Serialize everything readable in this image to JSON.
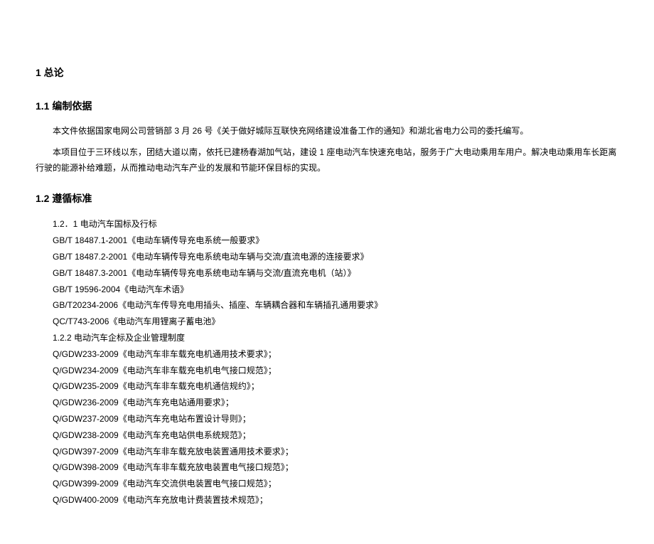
{
  "heading1": "1 总论",
  "section1": {
    "heading": "1.1  编制依据",
    "para1": "本文件依据国家电网公司营销部 3 月 26 号《关于做好城际互联快充网络建设准备工作的通知》和湖北省电力公司的委托编写。",
    "para2": "本项目位于三环线以东，团结大道以南，依托已建杨春湖加气站，建设 1 座电动汽车快速充电站，服务于广大电动乘用车用户。解决电动乘用车长距离行驶的能源补给难题，从而推动电动汽车产业的发展和节能环保目标的实现。"
  },
  "section2": {
    "heading": "1.2  遵循标准",
    "sub1": "1.2．1 电动汽车国标及行标",
    "group1": [
      "GB/T 18487.1-2001《电动车辆传导充电系统一般要求》",
      "GB/T 18487.2-2001《电动车辆传导充电系统电动车辆与交流/直流电源的连接要求》",
      "GB/T 18487.3-2001《电动车辆传导充电系统电动车辆与交流/直流充电机（站）》",
      "GB/T 19596-2004《电动汽车术语》",
      "GB/T20234-2006《电动汽车传导充电用插头、插座、车辆耦合器和车辆插孔通用要求》",
      "QC/T743-2006《电动汽车用锂离子蓄电池》"
    ],
    "sub2": "1.2.2 电动汽车企标及企业管理制度",
    "group2": [
      "Q/GDW233-2009《电动汽车非车载充电机通用技术要求》；",
      "Q/GDW234-2009《电动汽车非车载充电机电气接口规范》；",
      "Q/GDW235-2009《电动汽车非车载充电机通信规约》；",
      "Q/GDW236-2009《电动汽车充电站通用要求》；",
      "Q/GDW237-2009《电动汽车充电站布置设计导则》；",
      "Q/GDW238-2009《电动汽车充电站供电系统规范》；",
      "Q/GDW397-2009《电动汽车非车载充放电装置通用技术要求》；",
      "Q/GDW398-2009《电动汽车非车载充放电装置电气接口规范》；",
      "Q/GDW399-2009《电动汽车交流供电装置电气接口规范》；",
      "Q/GDW400-2009《电动汽车充放电计费装置技术规范》；"
    ]
  }
}
